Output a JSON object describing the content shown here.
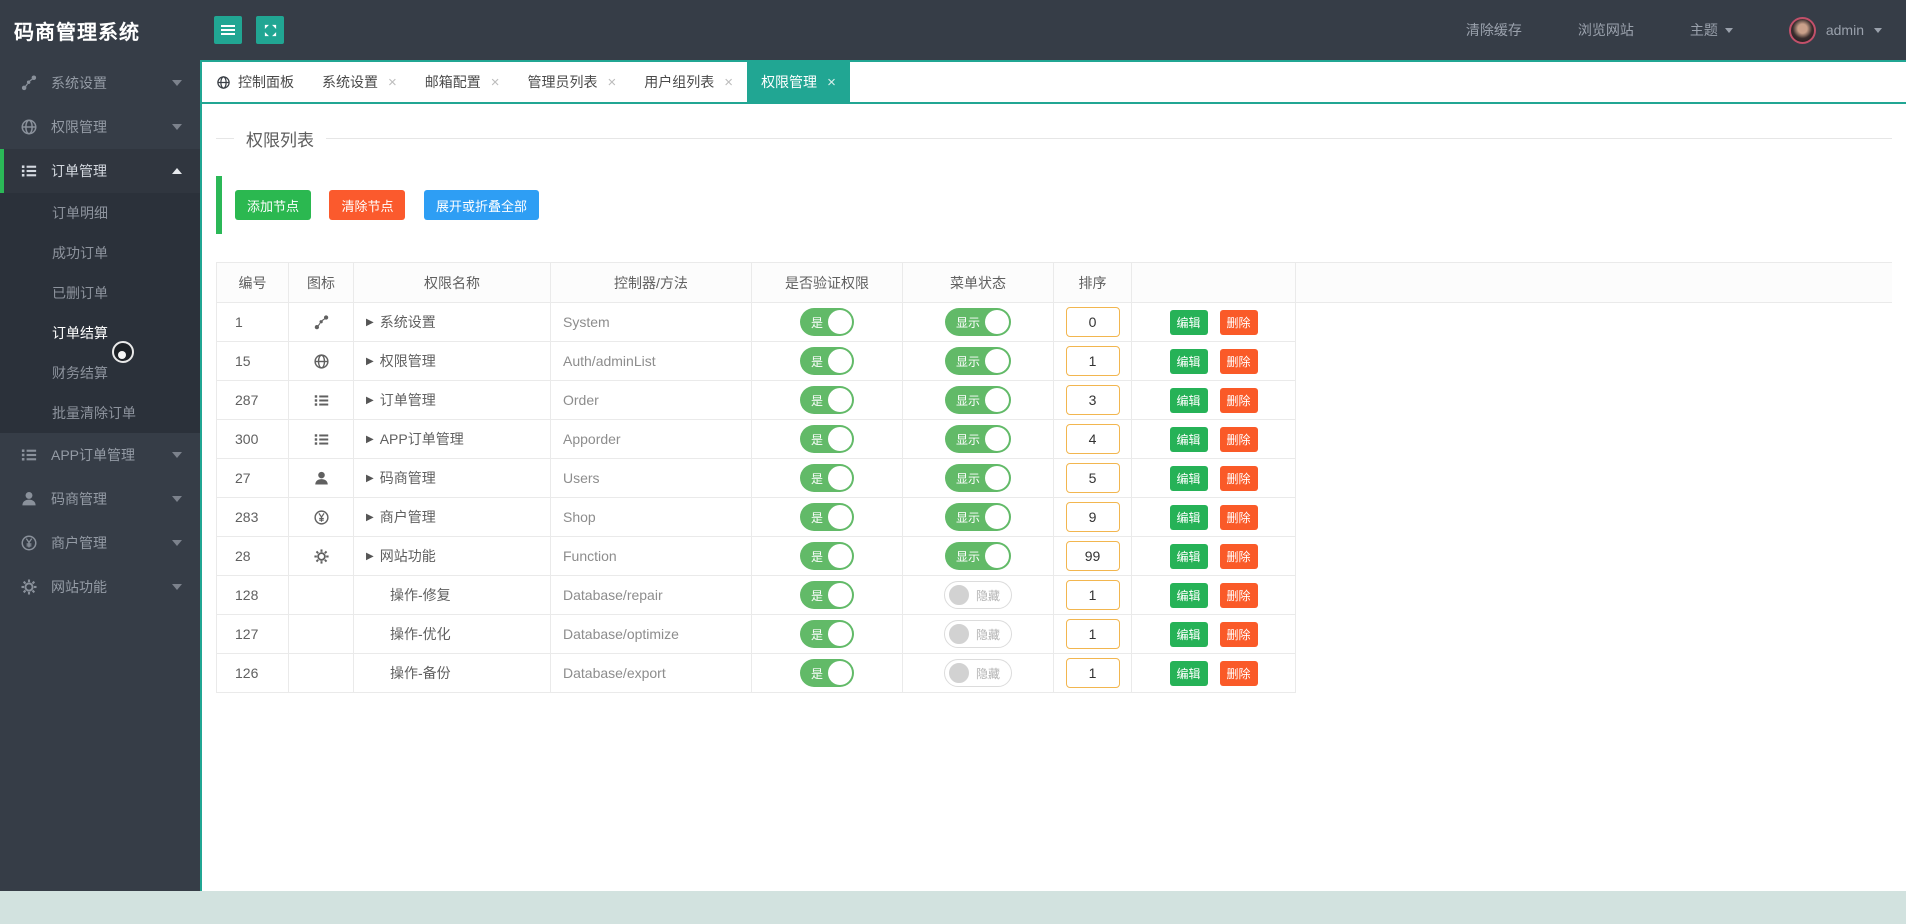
{
  "app": {
    "title": "码商管理系统"
  },
  "navbar": {
    "clear_cache": "清除缓存",
    "browse_site": "浏览网站",
    "theme": "主题",
    "username": "admin"
  },
  "sidebar": {
    "items": [
      {
        "label": "系统设置",
        "icon": "share-nodes",
        "expanded": false
      },
      {
        "label": "权限管理",
        "icon": "globe",
        "expanded": false
      },
      {
        "label": "订单管理",
        "icon": "list",
        "expanded": true,
        "active": true
      },
      {
        "label": "APP订单管理",
        "icon": "list",
        "expanded": false
      },
      {
        "label": "码商管理",
        "icon": "user",
        "expanded": false
      },
      {
        "label": "商户管理",
        "icon": "yen-circle",
        "expanded": false
      },
      {
        "label": "网站功能",
        "icon": "gear",
        "expanded": false
      }
    ],
    "order_submenu": [
      {
        "label": "订单明细",
        "active": false
      },
      {
        "label": "成功订单",
        "active": false
      },
      {
        "label": "已删订单",
        "active": false
      },
      {
        "label": "订单结算",
        "active": true
      },
      {
        "label": "财务结算",
        "active": false
      },
      {
        "label": "批量清除订单",
        "active": false
      }
    ]
  },
  "tabs": {
    "close_glyph": "×",
    "items": [
      {
        "label": "控制面板",
        "icon": "globe",
        "closable": false,
        "active": false
      },
      {
        "label": "系统设置",
        "closable": true,
        "active": false
      },
      {
        "label": "邮箱配置",
        "closable": true,
        "active": false
      },
      {
        "label": "管理员列表",
        "closable": true,
        "active": false
      },
      {
        "label": "用户组列表",
        "closable": true,
        "active": false
      },
      {
        "label": "权限管理",
        "closable": true,
        "active": true
      }
    ]
  },
  "page": {
    "title": "权限列表"
  },
  "toolbar": {
    "add_label": "添加节点",
    "clear_label": "清除节点",
    "expand_label": "展开或折叠全部"
  },
  "table": {
    "headers": [
      "编号",
      "图标",
      "权限名称",
      "控制器/方法",
      "是否验证权限",
      "菜单状态",
      "排序",
      ""
    ],
    "edit_label": "编辑",
    "delete_label": "删除",
    "rows": [
      {
        "id": "1",
        "icon": "share-nodes",
        "caret": "▶",
        "name": "系统设置",
        "controller": "System",
        "verify_label": "是",
        "menu_on": true,
        "menu_label": "显示",
        "sort": "0"
      },
      {
        "id": "15",
        "icon": "globe",
        "caret": "▶",
        "name": "权限管理",
        "controller": "Auth/adminList",
        "verify_label": "是",
        "menu_on": true,
        "menu_label": "显示",
        "sort": "1"
      },
      {
        "id": "287",
        "icon": "list",
        "caret": "▶",
        "name": "订单管理",
        "controller": "Order",
        "verify_label": "是",
        "menu_on": true,
        "menu_label": "显示",
        "sort": "3"
      },
      {
        "id": "300",
        "icon": "list",
        "caret": "▶",
        "name": "APP订单管理",
        "controller": "Apporder",
        "verify_label": "是",
        "menu_on": true,
        "menu_label": "显示",
        "sort": "4"
      },
      {
        "id": "27",
        "icon": "user",
        "caret": "▶",
        "name": "码商管理",
        "controller": "Users",
        "verify_label": "是",
        "menu_on": true,
        "menu_label": "显示",
        "sort": "5"
      },
      {
        "id": "283",
        "icon": "yen-circle",
        "caret": "▶",
        "name": "商户管理",
        "controller": "Shop",
        "verify_label": "是",
        "menu_on": true,
        "menu_label": "显示",
        "sort": "9"
      },
      {
        "id": "28",
        "icon": "gear",
        "caret": "▶",
        "name": "网站功能",
        "controller": "Function",
        "verify_label": "是",
        "menu_on": true,
        "menu_label": "显示",
        "sort": "99"
      },
      {
        "id": "128",
        "icon": "",
        "caret": "",
        "name": "操作-修复",
        "controller": "Database/repair",
        "verify_label": "是",
        "menu_on": false,
        "menu_label": "隐藏",
        "sort": "1"
      },
      {
        "id": "127",
        "icon": "",
        "caret": "",
        "name": "操作-优化",
        "controller": "Database/optimize",
        "verify_label": "是",
        "menu_on": false,
        "menu_label": "隐藏",
        "sort": "1"
      },
      {
        "id": "126",
        "icon": "",
        "caret": "",
        "name": "操作-备份",
        "controller": "Database/export",
        "verify_label": "是",
        "menu_on": false,
        "menu_label": "隐藏",
        "sort": "1"
      }
    ]
  },
  "colors": {
    "accent_teal": "#21a693",
    "sidebar_dark": "#363d47",
    "submenu_dark": "#2b313a",
    "button_green": "#2bb850",
    "button_orange": "#fb5a2d",
    "button_blue": "#2e9ef4",
    "toggle_on_green": "#62ba68",
    "sort_input_border": "#f2b64f",
    "edit_green": "#26b257",
    "delete_orange": "#fa5a28"
  }
}
